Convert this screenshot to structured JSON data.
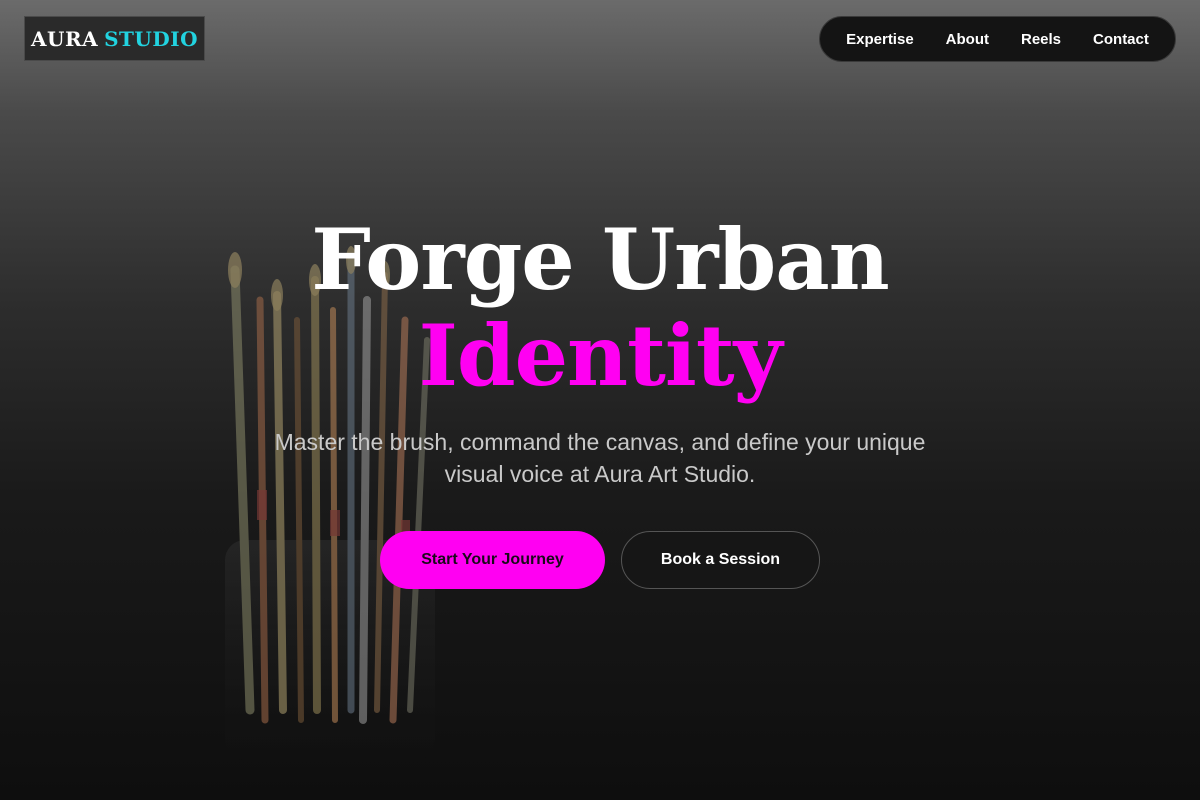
{
  "logo": {
    "word_a": "AURA",
    "word_b": "STUDIO"
  },
  "nav": {
    "items": [
      "Expertise",
      "About",
      "Reels",
      "Contact"
    ]
  },
  "hero": {
    "title_line1": "Forge Urban",
    "title_line2": "Identity",
    "subtitle": "Master the brush, command the canvas, and define your unique visual voice at Aura Art Studio.",
    "primary_cta": "Start Your Journey",
    "secondary_cta": "Book a Session"
  },
  "colors": {
    "accent_magenta": "#ff00f2",
    "accent_cyan": "#22d3e0",
    "background_dark": "#0e0e0e"
  },
  "icons": [
    "paint-brushes-illustration"
  ]
}
